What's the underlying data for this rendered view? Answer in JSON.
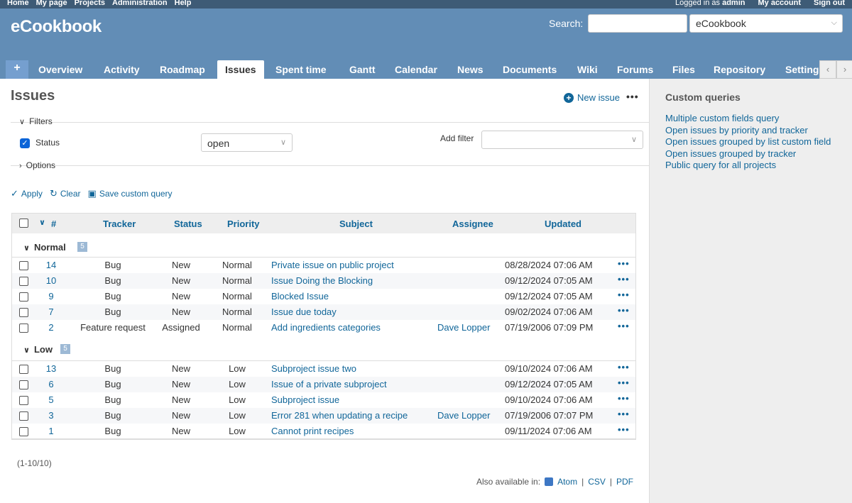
{
  "top_menu": {
    "items": [
      "Home",
      "My page",
      "Projects",
      "Administration",
      "Help"
    ],
    "logged_in_prefix": "Logged in as",
    "user": "admin",
    "my_account": "My account",
    "sign_out": "Sign out"
  },
  "header": {
    "title": "eCookbook",
    "search_label": "Search:",
    "project_select": "eCookbook"
  },
  "tabs": {
    "plus": "+",
    "items": [
      "Overview",
      "Activity",
      "Roadmap",
      "Issues",
      "Spent time",
      "Gantt",
      "Calendar",
      "News",
      "Documents",
      "Wiki",
      "Forums",
      "Files",
      "Repository",
      "Settings"
    ],
    "selected": "Issues"
  },
  "main": {
    "title": "Issues",
    "new_issue": "New issue",
    "more": "•••",
    "filters_label": "Filters",
    "status_filter_label": "Status",
    "status_filter_value": "open",
    "add_filter_label": "Add filter",
    "options_label": "Options",
    "apply": "Apply",
    "clear": "Clear",
    "save_query": "Save custom query"
  },
  "table": {
    "headers": {
      "sort": "#",
      "tracker": "Tracker",
      "status": "Status",
      "priority": "Priority",
      "subject": "Subject",
      "assignee": "Assignee",
      "updated": "Updated"
    },
    "groups": [
      {
        "name": "Normal",
        "count": "5",
        "rows": [
          {
            "id": "14",
            "tracker": "Bug",
            "status": "New",
            "priority": "Normal",
            "subject": "Private issue on public project",
            "assignee": "",
            "updated": "08/28/2024 07:06 AM"
          },
          {
            "id": "10",
            "tracker": "Bug",
            "status": "New",
            "priority": "Normal",
            "subject": "Issue Doing the Blocking",
            "assignee": "",
            "updated": "09/12/2024 07:05 AM"
          },
          {
            "id": "9",
            "tracker": "Bug",
            "status": "New",
            "priority": "Normal",
            "subject": "Blocked Issue",
            "assignee": "",
            "updated": "09/12/2024 07:05 AM"
          },
          {
            "id": "7",
            "tracker": "Bug",
            "status": "New",
            "priority": "Normal",
            "subject": "Issue due today",
            "assignee": "",
            "updated": "09/02/2024 07:06 AM"
          },
          {
            "id": "2",
            "tracker": "Feature request",
            "status": "Assigned",
            "priority": "Normal",
            "subject": "Add ingredients categories",
            "assignee": "Dave Lopper",
            "updated": "07/19/2006 07:09 PM"
          }
        ]
      },
      {
        "name": "Low",
        "count": "5",
        "rows": [
          {
            "id": "13",
            "tracker": "Bug",
            "status": "New",
            "priority": "Low",
            "subject": "Subproject issue two",
            "assignee": "",
            "updated": "09/10/2024 07:06 AM"
          },
          {
            "id": "6",
            "tracker": "Bug",
            "status": "New",
            "priority": "Low",
            "subject": "Issue of a private subproject",
            "assignee": "",
            "updated": "09/12/2024 07:05 AM"
          },
          {
            "id": "5",
            "tracker": "Bug",
            "status": "New",
            "priority": "Low",
            "subject": "Subproject issue",
            "assignee": "",
            "updated": "09/10/2024 07:06 AM"
          },
          {
            "id": "3",
            "tracker": "Bug",
            "status": "New",
            "priority": "Low",
            "subject": "Error 281 when updating a recipe",
            "assignee": "Dave Lopper",
            "updated": "07/19/2006 07:07 PM"
          },
          {
            "id": "1",
            "tracker": "Bug",
            "status": "New",
            "priority": "Low",
            "subject": "Cannot print recipes",
            "assignee": "",
            "updated": "09/11/2024 07:06 AM"
          }
        ]
      }
    ]
  },
  "pagination": "(1-10/10)",
  "other_formats": {
    "label": "Also available in:",
    "atom": "Atom",
    "csv": "CSV",
    "pdf": "PDF",
    "sep": "|"
  },
  "sidebar": {
    "title": "Custom queries",
    "queries": [
      "Multiple custom fields query",
      "Open issues by priority and tracker",
      "Open issues grouped by list custom field",
      "Open issues grouped by tracker",
      "Public query for all projects"
    ]
  }
}
